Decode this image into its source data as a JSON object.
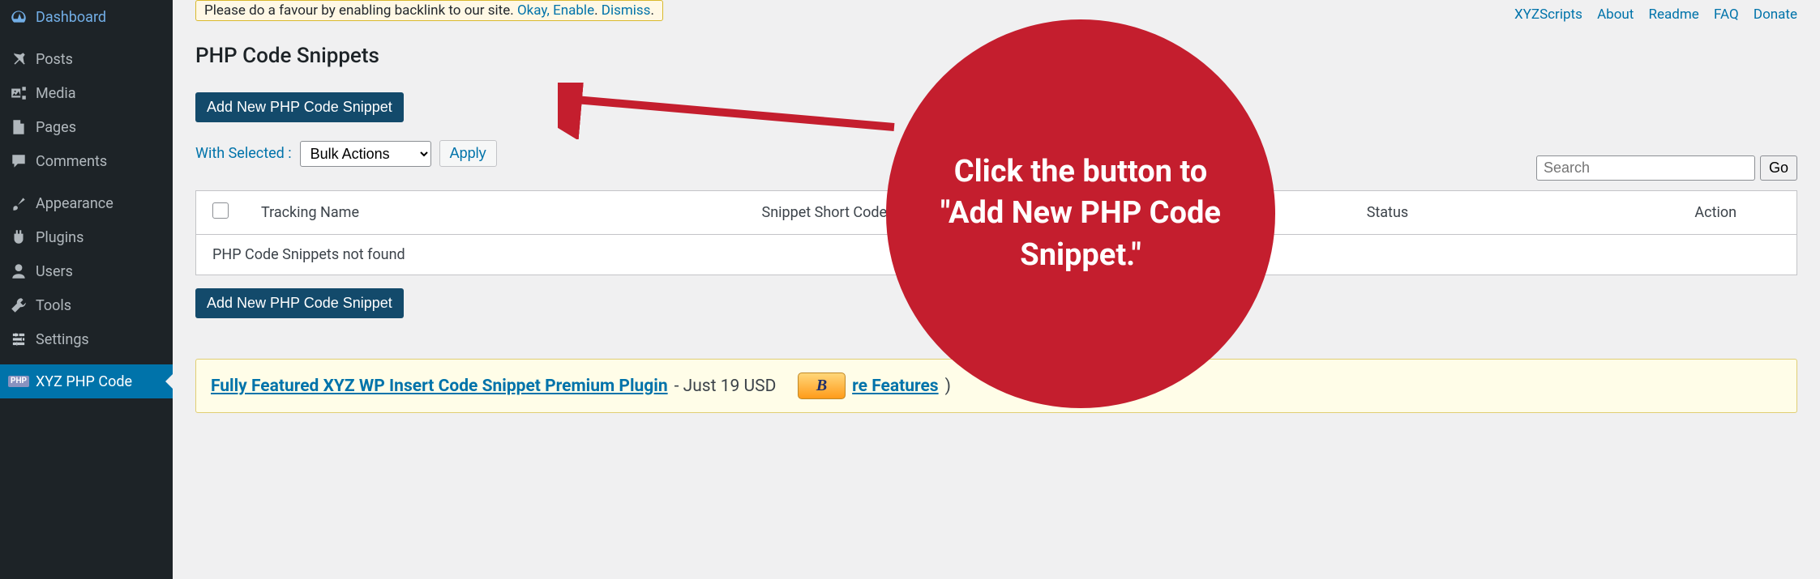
{
  "sidebar": {
    "items": [
      {
        "label": "Dashboard"
      },
      {
        "label": "Posts"
      },
      {
        "label": "Media"
      },
      {
        "label": "Pages"
      },
      {
        "label": "Comments"
      },
      {
        "label": "Appearance"
      },
      {
        "label": "Plugins"
      },
      {
        "label": "Users"
      },
      {
        "label": "Tools"
      },
      {
        "label": "Settings"
      },
      {
        "label": "XYZ PHP Code"
      }
    ]
  },
  "notice": {
    "text": "Please do a favour by enabling backlink to our site. ",
    "link1": "Okay, Enable",
    "link2": "Dismiss"
  },
  "top_links": [
    "XYZScripts",
    "About",
    "Readme",
    "FAQ",
    "Donate"
  ],
  "page_title": "PHP Code Snippets",
  "add_button": "Add New PHP Code Snippet",
  "bulk": {
    "label": "With Selected :",
    "selected": "Bulk Actions",
    "apply": "Apply"
  },
  "search": {
    "placeholder": "Search",
    "go": "Go"
  },
  "table": {
    "columns": [
      "",
      "Tracking Name",
      "Snippet Short Code",
      "Status",
      "Action"
    ],
    "empty": "PHP Code Snippets not found"
  },
  "promo": {
    "link_text": "Fully Featured XYZ WP Insert Code Snippet Premium Plugin",
    "price": " - Just 19 USD",
    "buy": "B",
    "features_link": "re Features",
    "paren_close": " )"
  },
  "callout": {
    "text": "Click the button to \"Add New PHP Code Snippet.\""
  }
}
